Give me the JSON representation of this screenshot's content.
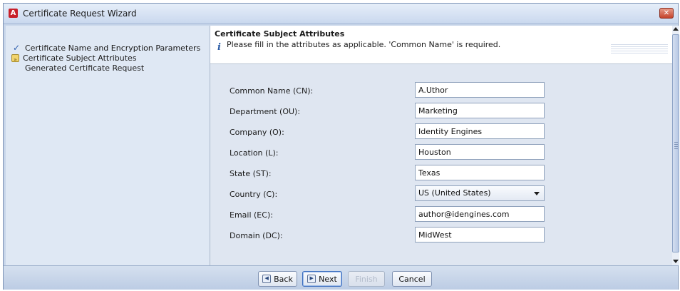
{
  "window": {
    "title": "Certificate Request Wizard"
  },
  "sidebar": {
    "steps": [
      {
        "label": "Certificate Name and Encryption Parameters",
        "state": "completed",
        "icon": "checkmark-icon"
      },
      {
        "label": "Certificate Subject Attributes",
        "state": "current",
        "icon": "current-step-icon"
      },
      {
        "label": "Generated Certificate Request",
        "state": "pending",
        "icon": ""
      }
    ]
  },
  "header": {
    "title": "Certificate Subject Attributes",
    "message": "Please fill in the attributes as applicable. 'Common Name' is required."
  },
  "form": {
    "fields": [
      {
        "label": "Common Name (CN):",
        "value": "A.Uthor"
      },
      {
        "label": "Department (OU):",
        "value": "Marketing"
      },
      {
        "label": "Company (O):",
        "value": "Identity Engines"
      },
      {
        "label": "Location (L):",
        "value": "Houston"
      },
      {
        "label": "State (ST):",
        "value": "Texas"
      },
      {
        "label": "Country (C):",
        "value": "US  (United States)",
        "type": "select"
      },
      {
        "label": "Email (EC):",
        "value": "author@idengines.com"
      },
      {
        "label": "Domain (DC):",
        "value": "MidWest"
      }
    ]
  },
  "footer": {
    "back_label": "Back",
    "next_label": "Next",
    "finish_label": "Finish",
    "cancel_label": "Cancel"
  },
  "colors": {
    "accent": "#2f5fae",
    "close": "#c4432b",
    "app_icon": "#c8202a"
  }
}
